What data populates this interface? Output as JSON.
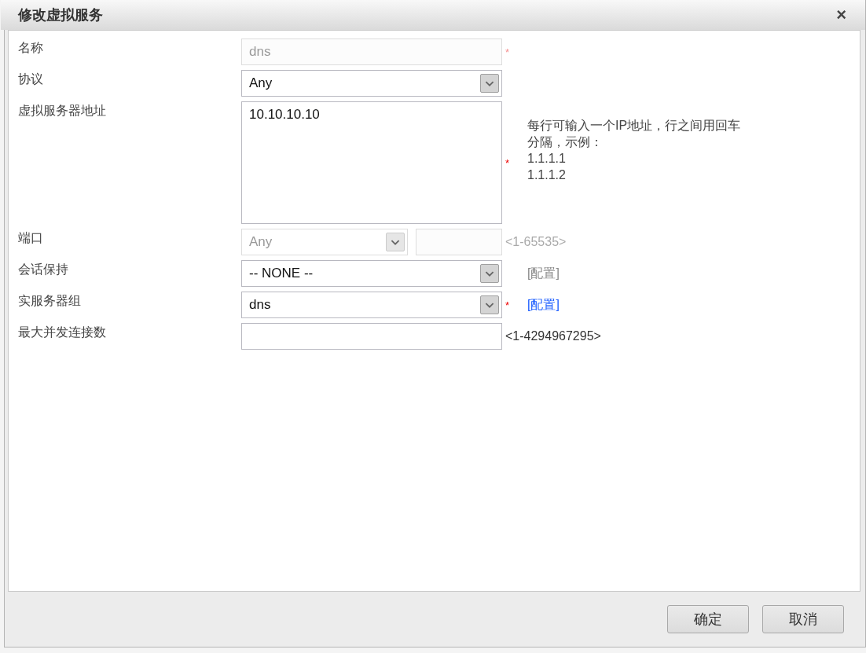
{
  "dialog": {
    "title": "修改虚拟服务",
    "close": "×"
  },
  "fields": [
    {
      "label": "名称",
      "kind": "text",
      "value": "dns",
      "disabled": true,
      "required": true
    },
    {
      "label": "协议",
      "kind": "select",
      "value": "Any",
      "disabled": false,
      "required": false
    },
    {
      "label": "虚拟服务器地址",
      "kind": "textarea",
      "value": "10.10.10.10",
      "disabled": false,
      "required": true,
      "hint": {
        "kind": "note",
        "lines": [
          "每行可输入一个IP地址，行之间用回车分隔，示例：",
          "1.1.1.1",
          "1.1.1.2"
        ]
      }
    },
    {
      "label": "端口",
      "kind": "port",
      "value": "Any",
      "disabled": true,
      "required": false,
      "hint": {
        "kind": "range",
        "text": "<1-65535>",
        "disabled": true
      }
    },
    {
      "label": "会话保持",
      "kind": "select",
      "value": "-- NONE --",
      "disabled": false,
      "required": false,
      "hint": {
        "kind": "link",
        "text": "[配置]",
        "disabled": true
      }
    },
    {
      "label": "实服务器组",
      "kind": "select",
      "value": "dns",
      "disabled": false,
      "required": true,
      "hint": {
        "kind": "link",
        "text": "[配置]",
        "disabled": false
      }
    },
    {
      "label": "最大并发连接数",
      "kind": "text",
      "disabled": false,
      "required": false,
      "hint": {
        "kind": "range",
        "text": "<1-4294967295>",
        "disabled": false
      }
    }
  ],
  "required_mark": "*",
  "buttons": [
    {
      "label": "确定"
    },
    {
      "label": "取消"
    }
  ]
}
